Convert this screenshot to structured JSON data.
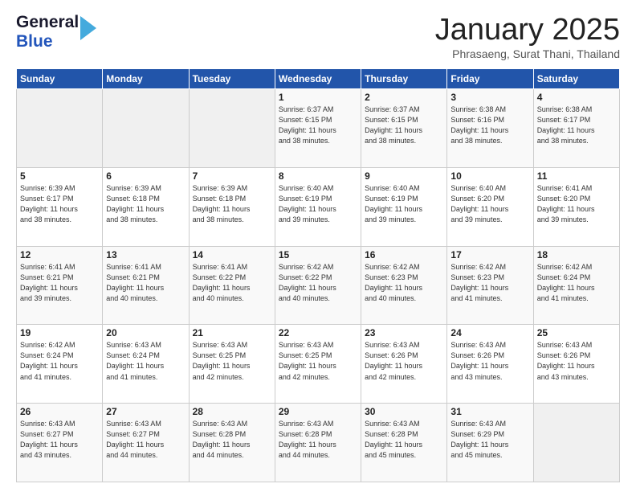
{
  "header": {
    "logo_general": "General",
    "logo_blue": "Blue",
    "month": "January 2025",
    "location": "Phrasaeng, Surat Thani, Thailand"
  },
  "days_of_week": [
    "Sunday",
    "Monday",
    "Tuesday",
    "Wednesday",
    "Thursday",
    "Friday",
    "Saturday"
  ],
  "weeks": [
    [
      {
        "day": "",
        "info": ""
      },
      {
        "day": "",
        "info": ""
      },
      {
        "day": "",
        "info": ""
      },
      {
        "day": "1",
        "info": "Sunrise: 6:37 AM\nSunset: 6:15 PM\nDaylight: 11 hours\nand 38 minutes."
      },
      {
        "day": "2",
        "info": "Sunrise: 6:37 AM\nSunset: 6:15 PM\nDaylight: 11 hours\nand 38 minutes."
      },
      {
        "day": "3",
        "info": "Sunrise: 6:38 AM\nSunset: 6:16 PM\nDaylight: 11 hours\nand 38 minutes."
      },
      {
        "day": "4",
        "info": "Sunrise: 6:38 AM\nSunset: 6:17 PM\nDaylight: 11 hours\nand 38 minutes."
      }
    ],
    [
      {
        "day": "5",
        "info": "Sunrise: 6:39 AM\nSunset: 6:17 PM\nDaylight: 11 hours\nand 38 minutes."
      },
      {
        "day": "6",
        "info": "Sunrise: 6:39 AM\nSunset: 6:18 PM\nDaylight: 11 hours\nand 38 minutes."
      },
      {
        "day": "7",
        "info": "Sunrise: 6:39 AM\nSunset: 6:18 PM\nDaylight: 11 hours\nand 38 minutes."
      },
      {
        "day": "8",
        "info": "Sunrise: 6:40 AM\nSunset: 6:19 PM\nDaylight: 11 hours\nand 39 minutes."
      },
      {
        "day": "9",
        "info": "Sunrise: 6:40 AM\nSunset: 6:19 PM\nDaylight: 11 hours\nand 39 minutes."
      },
      {
        "day": "10",
        "info": "Sunrise: 6:40 AM\nSunset: 6:20 PM\nDaylight: 11 hours\nand 39 minutes."
      },
      {
        "day": "11",
        "info": "Sunrise: 6:41 AM\nSunset: 6:20 PM\nDaylight: 11 hours\nand 39 minutes."
      }
    ],
    [
      {
        "day": "12",
        "info": "Sunrise: 6:41 AM\nSunset: 6:21 PM\nDaylight: 11 hours\nand 39 minutes."
      },
      {
        "day": "13",
        "info": "Sunrise: 6:41 AM\nSunset: 6:21 PM\nDaylight: 11 hours\nand 40 minutes."
      },
      {
        "day": "14",
        "info": "Sunrise: 6:41 AM\nSunset: 6:22 PM\nDaylight: 11 hours\nand 40 minutes."
      },
      {
        "day": "15",
        "info": "Sunrise: 6:42 AM\nSunset: 6:22 PM\nDaylight: 11 hours\nand 40 minutes."
      },
      {
        "day": "16",
        "info": "Sunrise: 6:42 AM\nSunset: 6:23 PM\nDaylight: 11 hours\nand 40 minutes."
      },
      {
        "day": "17",
        "info": "Sunrise: 6:42 AM\nSunset: 6:23 PM\nDaylight: 11 hours\nand 41 minutes."
      },
      {
        "day": "18",
        "info": "Sunrise: 6:42 AM\nSunset: 6:24 PM\nDaylight: 11 hours\nand 41 minutes."
      }
    ],
    [
      {
        "day": "19",
        "info": "Sunrise: 6:42 AM\nSunset: 6:24 PM\nDaylight: 11 hours\nand 41 minutes."
      },
      {
        "day": "20",
        "info": "Sunrise: 6:43 AM\nSunset: 6:24 PM\nDaylight: 11 hours\nand 41 minutes."
      },
      {
        "day": "21",
        "info": "Sunrise: 6:43 AM\nSunset: 6:25 PM\nDaylight: 11 hours\nand 42 minutes."
      },
      {
        "day": "22",
        "info": "Sunrise: 6:43 AM\nSunset: 6:25 PM\nDaylight: 11 hours\nand 42 minutes."
      },
      {
        "day": "23",
        "info": "Sunrise: 6:43 AM\nSunset: 6:26 PM\nDaylight: 11 hours\nand 42 minutes."
      },
      {
        "day": "24",
        "info": "Sunrise: 6:43 AM\nSunset: 6:26 PM\nDaylight: 11 hours\nand 43 minutes."
      },
      {
        "day": "25",
        "info": "Sunrise: 6:43 AM\nSunset: 6:26 PM\nDaylight: 11 hours\nand 43 minutes."
      }
    ],
    [
      {
        "day": "26",
        "info": "Sunrise: 6:43 AM\nSunset: 6:27 PM\nDaylight: 11 hours\nand 43 minutes."
      },
      {
        "day": "27",
        "info": "Sunrise: 6:43 AM\nSunset: 6:27 PM\nDaylight: 11 hours\nand 44 minutes."
      },
      {
        "day": "28",
        "info": "Sunrise: 6:43 AM\nSunset: 6:28 PM\nDaylight: 11 hours\nand 44 minutes."
      },
      {
        "day": "29",
        "info": "Sunrise: 6:43 AM\nSunset: 6:28 PM\nDaylight: 11 hours\nand 44 minutes."
      },
      {
        "day": "30",
        "info": "Sunrise: 6:43 AM\nSunset: 6:28 PM\nDaylight: 11 hours\nand 45 minutes."
      },
      {
        "day": "31",
        "info": "Sunrise: 6:43 AM\nSunset: 6:29 PM\nDaylight: 11 hours\nand 45 minutes."
      },
      {
        "day": "",
        "info": ""
      }
    ]
  ]
}
